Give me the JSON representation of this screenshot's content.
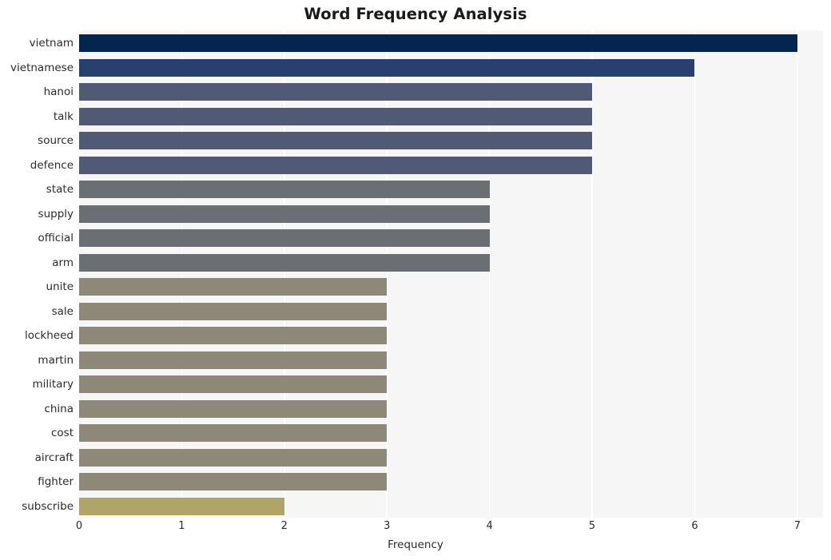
{
  "chart_data": {
    "type": "bar",
    "orientation": "horizontal",
    "title": "Word Frequency Analysis",
    "xlabel": "Frequency",
    "ylabel": "",
    "xlim": [
      0,
      7.25
    ],
    "xticks": [
      0,
      1,
      2,
      3,
      4,
      5,
      6,
      7
    ],
    "xtick_labels": [
      "0",
      "1",
      "2",
      "3",
      "4",
      "5",
      "6",
      "7"
    ],
    "grid": "vertical-white-on-gray",
    "legend": "none",
    "categories": [
      "vietnam",
      "vietnamese",
      "hanoi",
      "talk",
      "source",
      "defence",
      "state",
      "supply",
      "official",
      "arm",
      "unite",
      "sale",
      "lockheed",
      "martin",
      "military",
      "china",
      "cost",
      "aircraft",
      "fighter",
      "subscribe"
    ],
    "values": [
      7,
      6,
      5,
      5,
      5,
      5,
      4,
      4,
      4,
      4,
      3,
      3,
      3,
      3,
      3,
      3,
      3,
      3,
      3,
      2
    ],
    "bar_colors": [
      "#032550",
      "#293f70",
      "#515a75",
      "#515a75",
      "#515a75",
      "#515a75",
      "#6b6e73",
      "#6b6e73",
      "#6b6e73",
      "#6b6e73",
      "#8d8878",
      "#8d8878",
      "#8d8878",
      "#8d8878",
      "#8d8878",
      "#8d8878",
      "#8d8878",
      "#8d8878",
      "#8d8878",
      "#b0a567"
    ],
    "plot_background": "#f6f6f7",
    "figure_background": "#ffffff",
    "title_color": "#1a1a1a",
    "tick_color": "#2b2b2b"
  }
}
